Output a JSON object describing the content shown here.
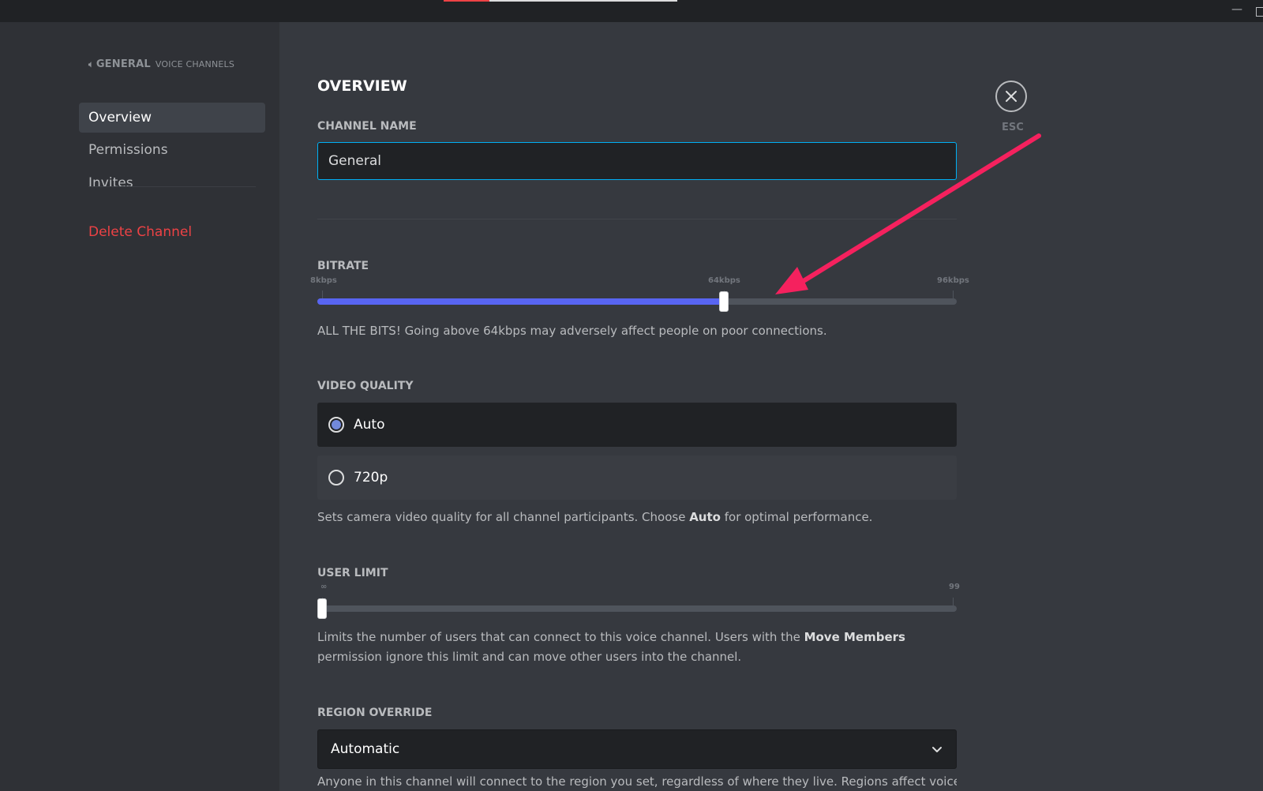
{
  "sidebar": {
    "header_icon": "speaker-icon",
    "header_title": "GENERAL",
    "header_subtitle": "VOICE CHANNELS",
    "items": [
      {
        "label": "Overview",
        "selected": true
      },
      {
        "label": "Permissions",
        "selected": false
      },
      {
        "label": "Invites",
        "selected": false
      }
    ],
    "danger_label": "Delete Channel"
  },
  "main": {
    "title": "OVERVIEW",
    "channel_name": {
      "label": "CHANNEL NAME",
      "value": "General"
    },
    "bitrate": {
      "label": "BITRATE",
      "min_label": "8kbps",
      "mid_label": "64kbps",
      "max_label": "96kbps",
      "value_kbps": 64,
      "description": "ALL THE BITS! Going above 64kbps may adversely affect people on poor connections."
    },
    "video_quality": {
      "label": "VIDEO QUALITY",
      "options": [
        {
          "label": "Auto",
          "selected": true
        },
        {
          "label": "720p",
          "selected": false
        }
      ],
      "desc_before": "Sets camera video quality for all channel participants. Choose ",
      "desc_bold": "Auto",
      "desc_after": " for optimal performance."
    },
    "user_limit": {
      "label": "USER LIMIT",
      "min_label": "∞",
      "max_label": "99",
      "value": 0,
      "desc_before": "Limits the number of users that can connect to this voice channel. Users with the ",
      "desc_bold": "Move Members",
      "desc_after": " permission ignore this limit and can move other users into the channel."
    },
    "region_override": {
      "label": "REGION OVERRIDE",
      "selected": "Automatic",
      "description": "Anyone in this channel will connect to the region you set, regardless of where they live. Regions affect voice and"
    }
  },
  "close": {
    "icon": "close-icon",
    "label": "ESC"
  },
  "colors": {
    "accent": "#5865f2",
    "danger": "#ed4245",
    "annotation_arrow": "#f5215e",
    "input_focus": "#00b0f4"
  }
}
